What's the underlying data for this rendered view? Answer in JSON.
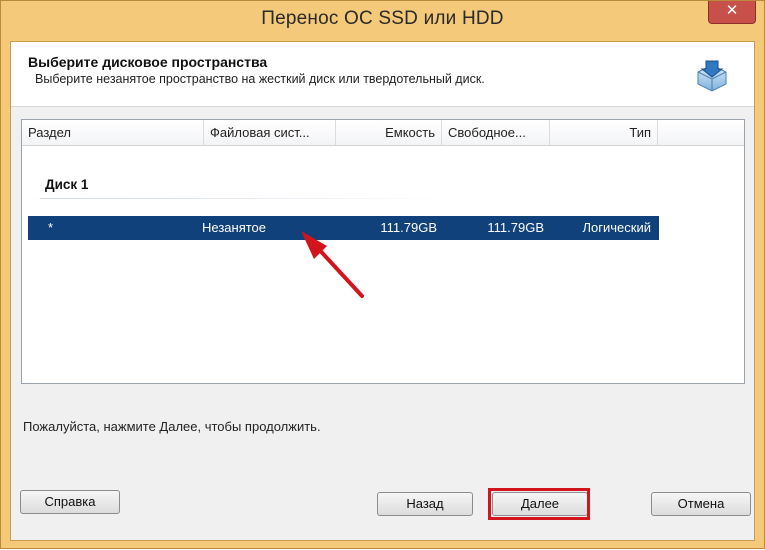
{
  "window": {
    "title": "Перенос ОС SSD или HDD",
    "close_label": "✕"
  },
  "header": {
    "title": "Выберите дисковое пространства",
    "subtitle": "Выберите незанятое пространство на жесткий диск или твердотельный диск.",
    "icon": "disk-drive-icon"
  },
  "list": {
    "columns": [
      "Раздел",
      "Файловая сист...",
      "Емкость",
      "Свободное...",
      "Тип"
    ],
    "group_label": "Диск 1",
    "rows": [
      {
        "partition": "*",
        "filesystem": "Незанятое",
        "capacity": "111.79GB",
        "free": "111.79GB",
        "type": "Логический",
        "selected": true
      }
    ]
  },
  "status_text": "Пожалуйста, нажмите Далее, чтобы продолжить.",
  "buttons": {
    "help": "Справка",
    "back": "Назад",
    "next": "Далее",
    "cancel": "Отмена"
  },
  "colors": {
    "frame": "#f4c97a",
    "selection": "#10417a",
    "annotation": "#d4141c"
  }
}
